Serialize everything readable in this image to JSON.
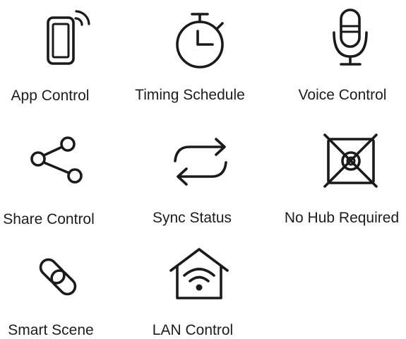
{
  "features": [
    {
      "label": "App Control",
      "icon": "smartphone-signal-icon"
    },
    {
      "label": "Timing Schedule",
      "icon": "stopwatch-icon"
    },
    {
      "label": "Voice Control",
      "icon": "microphone-icon"
    },
    {
      "label": "Share Control",
      "icon": "share-icon"
    },
    {
      "label": "Sync Status",
      "icon": "sync-arrows-icon"
    },
    {
      "label": "No Hub Required",
      "icon": "no-hub-icon"
    },
    {
      "label": "Smart Scene",
      "icon": "link-chain-icon"
    },
    {
      "label": "LAN Control",
      "icon": "home-wifi-icon"
    }
  ],
  "colors": {
    "icon": "#1a1a1a",
    "text": "#1c1c1c",
    "background": "#ffffff"
  }
}
